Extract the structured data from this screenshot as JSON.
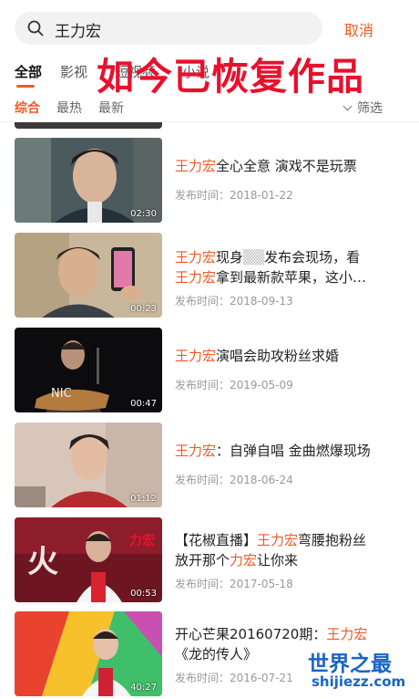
{
  "search": {
    "query": "王力宏",
    "cancel_label": "取消"
  },
  "tabs": [
    {
      "label": "全部"
    },
    {
      "label": "影视"
    },
    {
      "label": "短视频"
    },
    {
      "label": "小说"
    }
  ],
  "overlay_caption": "如今已恢复作品",
  "sub_tabs": [
    {
      "label": "综合"
    },
    {
      "label": "最热"
    },
    {
      "label": "最新"
    }
  ],
  "filter_label": "筛选",
  "results": [
    {
      "title_hl": "王力宏",
      "title_rest": "全心全意 演戏不是玩票",
      "date": "发布时间：2018-01-22",
      "duration": "02:30"
    },
    {
      "title_pre": "",
      "title_hl": "王力宏",
      "title_mid": "现身",
      "title_blur": "▒▒",
      "title_rest": "发布会现场，看",
      "title2_hl": "王力宏",
      "title2_rest": "拿到最新款苹果，这小…",
      "date": "发布时间：2018-09-13",
      "duration": "00:23"
    },
    {
      "title_hl": "王力宏",
      "title_rest": "演唱会助攻粉丝求婚",
      "date": "发布时间：2019-05-09",
      "duration": "00:47"
    },
    {
      "title_hl": "王力宏",
      "title_rest": "：自弹自唱 金曲燃爆现场",
      "date": "发布时间：2018-06-24",
      "duration": "01:12"
    },
    {
      "title_pre": "【花椒直播】",
      "title_hl": "王力宏",
      "title_rest": "弯腰抱粉丝",
      "title2_pre": "放开那个",
      "title2_hl": "力宏",
      "title2_rest": "让你来",
      "date": "发布时间：2017-05-18",
      "duration": "00:53"
    },
    {
      "title_pre": "开心芒果20160720期：",
      "title_hl": "王力宏",
      "title2_rest": "《龙的传人》",
      "date": "发布时间：2016-07-21",
      "duration": "40:27"
    }
  ],
  "watermark": {
    "cn": "世界之最",
    "en": "shijiezz.com"
  },
  "colors": {
    "accent": "#ee5a24",
    "overlay_red": "#e8112d",
    "watermark_blue": "#1a64c8"
  }
}
